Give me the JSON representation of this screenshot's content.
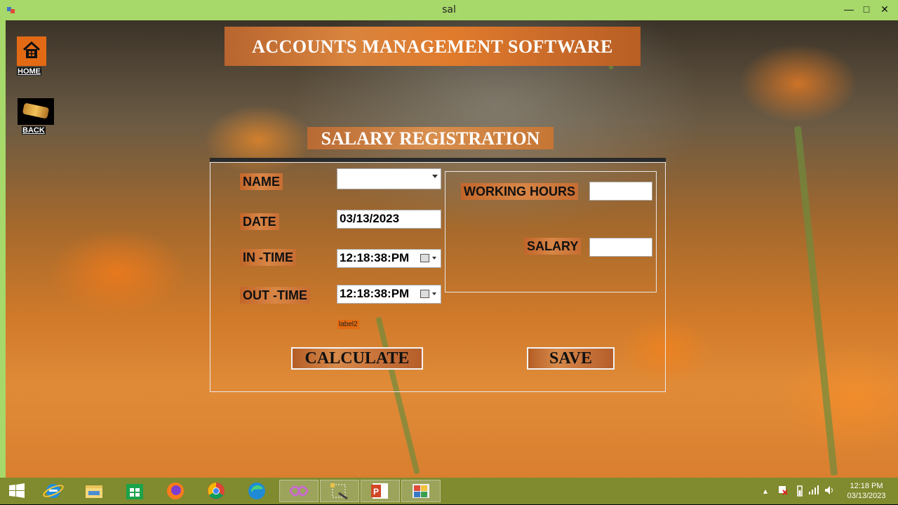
{
  "window": {
    "title": "sal",
    "minimize": "—",
    "maximize": "□",
    "close": "✕"
  },
  "sidebar": {
    "home_label": "HOME",
    "back_label": "BACK"
  },
  "header": {
    "app_title": "ACCOUNTS MANAGEMENT SOFTWARE",
    "page_title": "SALARY REGISTRATION"
  },
  "form": {
    "name_label": "NAME",
    "name_value": "",
    "date_label": "DATE",
    "date_value": "03/13/2023",
    "in_time_label": "IN -TIME",
    "in_time_value": "12:18:38:PM",
    "out_time_label": "OUT -TIME",
    "out_time_value": "12:18:38:PM",
    "status_label": "label2",
    "working_hours_label": "WORKING HOURS",
    "working_hours_value": "",
    "salary_label": "SALARY",
    "salary_value": "",
    "calculate_label": "CALCULATE",
    "save_label": "SAVE"
  },
  "taskbar": {
    "items": [
      "start",
      "internet-explorer",
      "file-explorer",
      "store",
      "firefox",
      "chrome",
      "edge",
      "app-1",
      "app-2",
      "powerpoint",
      "app-3"
    ],
    "clock_time": "12:18 PM",
    "clock_date": "03/13/2023"
  },
  "colors": {
    "titlebar": "#a6d86a",
    "label_bg": "#c2652a",
    "taskbar": "#808a2e",
    "accent_orange": "#e36a15"
  }
}
